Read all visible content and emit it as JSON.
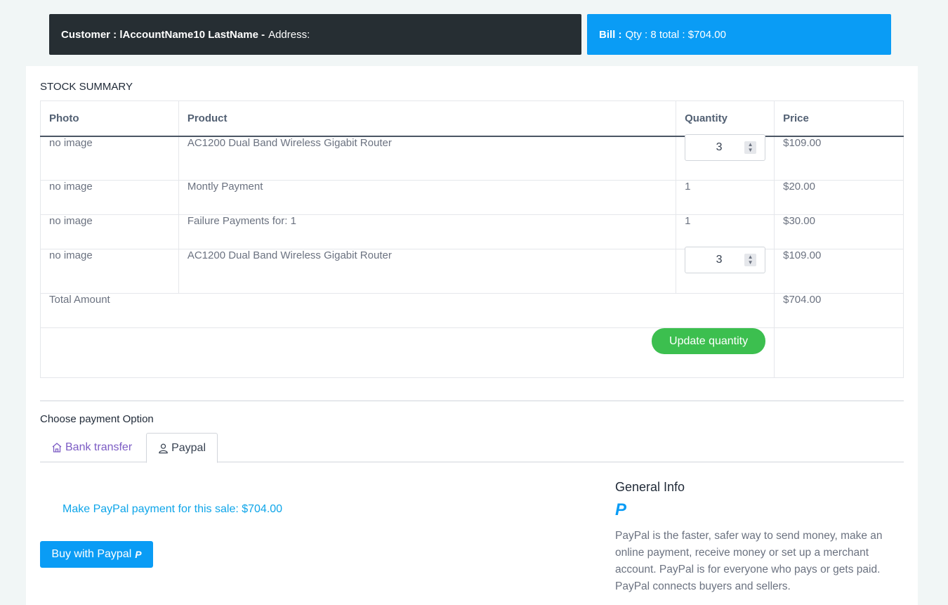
{
  "customer": {
    "label": "Customer : lAccountName10 LastName -",
    "address_label": "Address:"
  },
  "bill": {
    "label": "Bill :",
    "text": "Qty : 8 total : $704.00"
  },
  "stock": {
    "title": "STOCK SUMMARY",
    "headers": {
      "photo": "Photo",
      "product": "Product",
      "quantity": "Quantity",
      "price": "Price"
    },
    "rows": [
      {
        "photo": "no image",
        "product": "AC1200 Dual Band Wireless Gigabit Router",
        "quantity": "3",
        "price": "$109.00"
      },
      {
        "photo": "no image",
        "product": "Montly Payment",
        "quantity": "1",
        "price": "$20.00"
      },
      {
        "photo": "no image",
        "product": "Failure Payments for: 1",
        "quantity": "1",
        "price": "$30.00"
      },
      {
        "photo": "no image",
        "product": "AC1200 Dual Band Wireless Gigabit Router",
        "quantity": "3",
        "price": "$109.00"
      }
    ],
    "total_label": "Total Amount",
    "total_value": "$704.00",
    "update_button": "Update quantity"
  },
  "payment": {
    "title": "Choose payment Option",
    "tabs": {
      "bank": "Bank transfer",
      "paypal": "Paypal"
    },
    "active_tab": "paypal",
    "paypal_text": "Make PayPal payment for this sale: $704.00",
    "buy_button": "Buy with Paypal"
  },
  "general_info": {
    "title": "General Info",
    "description": "PayPal is the faster, safer way to send money, make an online payment, receive money or set up a merchant account. PayPal is for everyone who pays or gets paid. PayPal connects buyers and sellers."
  },
  "icons": {
    "bank_tab": "bank-icon",
    "paypal_tab": "user-icon",
    "paypal_logo": "paypal-icon"
  },
  "colors": {
    "dark_header": "#262e33",
    "accent_blue": "#0a9cf5",
    "success_green": "#3cbf4f",
    "bank_tab_purple": "#7c5cc4"
  }
}
